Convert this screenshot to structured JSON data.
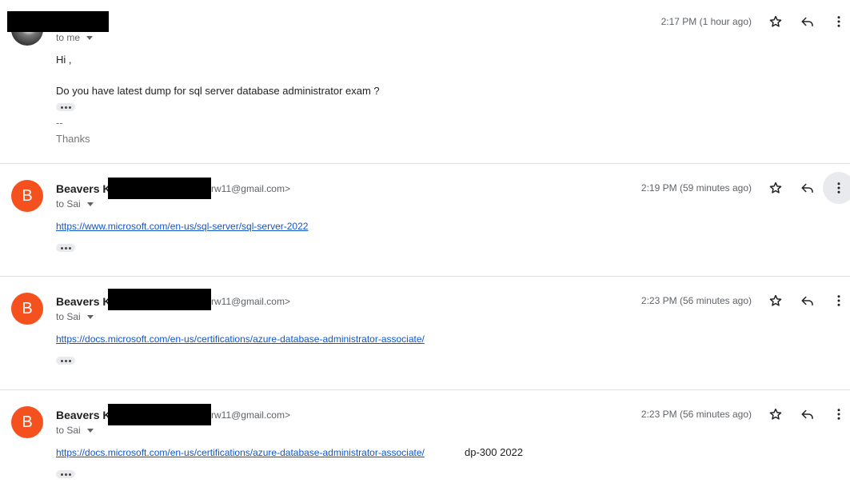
{
  "messages": [
    {
      "to_label": "to me",
      "timestamp": "2:17 PM (1 hour ago)",
      "greeting": "Hi ,",
      "body": "Do you have latest dump for sql server database administrator exam ?",
      "sig_dash": "--",
      "signature": "Thanks"
    },
    {
      "avatar_letter": "B",
      "sender_name": "Beavers K",
      "sender_email": "rw11@gmail.com>",
      "to_label": "to Sai",
      "timestamp": "2:19 PM (59 minutes ago)",
      "link": "https://www.microsoft.com/en-us/sql-server/sql-server-2022"
    },
    {
      "avatar_letter": "B",
      "sender_name": "Beavers K",
      "sender_email": "rw11@gmail.com>",
      "to_label": "to Sai",
      "timestamp": "2:23 PM (56 minutes ago)",
      "link": "https://docs.microsoft.com/en-us/certifications/azure-database-administrator-associate/"
    },
    {
      "avatar_letter": "B",
      "sender_name": "Beavers K",
      "sender_email": "rw11@gmail.com>",
      "to_label": "to Sai",
      "timestamp": "2:23 PM (56 minutes ago)",
      "link": "https://docs.microsoft.com/en-us/certifications/azure-database-administrator-associate/",
      "extra_text": "dp-300 2022"
    }
  ],
  "icons": [
    "star-icon",
    "reply-icon",
    "more-vert-icon",
    "chevron-down-icon",
    "ellipsis-icon"
  ],
  "colors": {
    "avatar_bg": "#f4511e",
    "link": "#1155cc",
    "secondary_text": "#5f6368"
  }
}
